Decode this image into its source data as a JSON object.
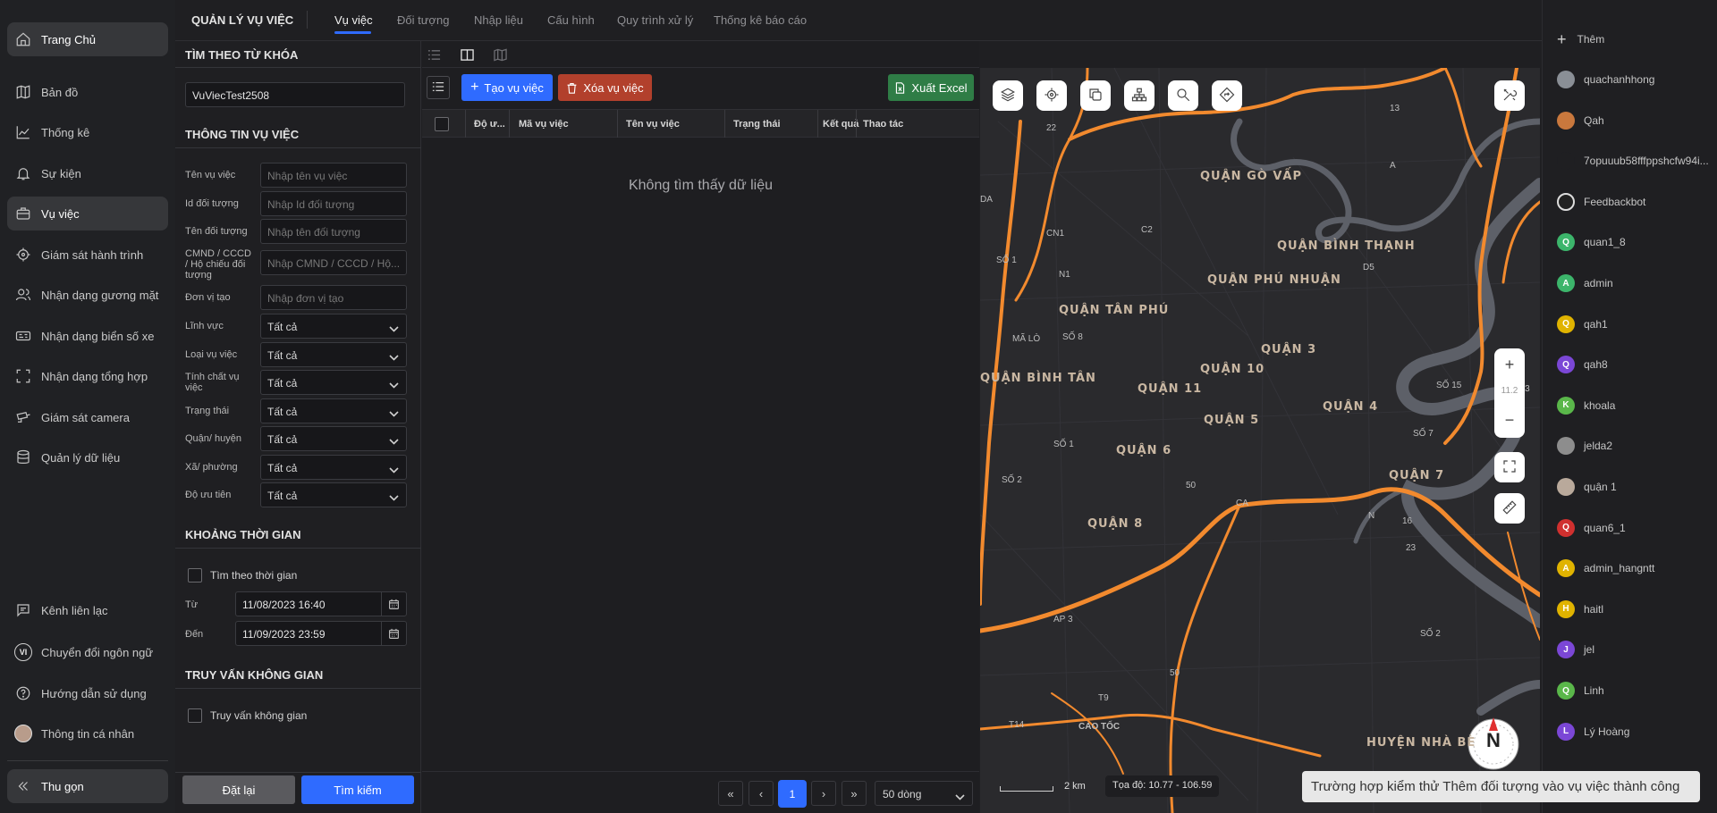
{
  "topbar": {
    "app_title": "QUẢN LÝ VỤ VIỆC",
    "tabs": [
      "Vụ việc",
      "Đối tượng",
      "Nhập liệu",
      "Cấu hình",
      "Quy trình xử lý",
      "Thống kê báo cáo"
    ],
    "active_tab": "Vụ việc"
  },
  "leftnav": {
    "items": [
      {
        "label": "Trang Chủ",
        "icon": "home-icon"
      },
      {
        "label": "Bản đồ",
        "icon": "map-icon"
      },
      {
        "label": "Thống kê",
        "icon": "chart-icon"
      },
      {
        "label": "Sự kiện",
        "icon": "bell-icon"
      },
      {
        "label": "Vụ việc",
        "icon": "briefcase-icon"
      },
      {
        "label": "Giám sát hành trình",
        "icon": "target-icon"
      },
      {
        "label": "Nhận dạng gương mặt",
        "icon": "face-icon"
      },
      {
        "label": "Nhận dạng biển số xe",
        "icon": "plate-icon"
      },
      {
        "label": "Nhận dạng tổng hợp",
        "icon": "scan-icon"
      },
      {
        "label": "Giám sát camera",
        "icon": "camera-icon"
      },
      {
        "label": "Quản lý dữ liệu",
        "icon": "database-icon"
      }
    ],
    "bottom_items": [
      {
        "label": "Kênh liên lạc",
        "icon": "chat-icon"
      },
      {
        "label": "Chuyển đổi ngôn ngữ",
        "icon": "language-icon",
        "badge": "VI"
      },
      {
        "label": "Hướng dẫn sử dụng",
        "icon": "help-icon"
      },
      {
        "label": "Thông tin cá nhân",
        "icon": "avatar-icon"
      }
    ],
    "collapse_label": "Thu gọn"
  },
  "filter": {
    "keyword_title": "TÌM THEO TỪ KHÓA",
    "keyword_value": "VuViecTest2508",
    "info_title": "THÔNG TIN VỤ VIỆC",
    "text_fields": [
      {
        "label": "Tên vụ việc",
        "placeholder": "Nhập tên vụ việc"
      },
      {
        "label": "Id đối tượng",
        "placeholder": "Nhập Id đối tượng"
      },
      {
        "label": "Tên đối tượng",
        "placeholder": "Nhập tên đối tượng"
      },
      {
        "label": "CMND / CCCD / Hộ chiếu đối tượng",
        "placeholder": "Nhập CMND / CCCD / Hộ..."
      },
      {
        "label": "Đơn vị tạo",
        "placeholder": "Nhập đơn vị tạo"
      }
    ],
    "select_fields": [
      {
        "label": "Lĩnh vực",
        "value": "Tất cả"
      },
      {
        "label": "Loại vụ việc",
        "value": "Tất cả"
      },
      {
        "label": "Tính chất vụ việc",
        "value": "Tất cả"
      },
      {
        "label": "Trạng thái",
        "value": "Tất cả"
      },
      {
        "label": "Quận/ huyện",
        "value": "Tất cả"
      },
      {
        "label": "Xã/ phường",
        "value": "Tất cả"
      },
      {
        "label": "Độ ưu tiên",
        "value": "Tất cả"
      }
    ],
    "time_title": "KHOẢNG THỜI GIAN",
    "time_checkbox": "Tìm theo thời gian",
    "from_label": "Từ",
    "from_value": "11/08/2023 16:40",
    "to_label": "Đến",
    "to_value": "11/09/2023 23:59",
    "spatial_title": "TRUY VẤN KHÔNG GIAN",
    "spatial_checkbox": "Truy vấn không gian",
    "reset_label": "Đặt lại",
    "search_label": "Tìm kiếm"
  },
  "table": {
    "create_label": "Tạo vụ việc",
    "delete_label": "Xóa vụ việc",
    "export_label": "Xuất Excel",
    "columns": [
      "Độ ư...",
      "Mã vụ việc",
      "Tên vụ việc",
      "Trạng thái",
      "Kết quả",
      "Thao tác"
    ],
    "empty_text": "Không tìm thấy dữ liệu",
    "current_page": "1",
    "page_size": "50 dòng"
  },
  "map": {
    "district_labels": [
      "QUẬN GÒ VẤP",
      "QUẬN BÌNH THẠNH",
      "QUẬN PHÚ NHUẬN",
      "QUẬN TÂN PHÚ",
      "QUẬN 3",
      "QUẬN 10",
      "QUẬN BÌNH TÂN",
      "QUẬN 11",
      "QUẬN 5",
      "QUẬN 4",
      "QUẬN 6",
      "QUẬN 7",
      "QUẬN 8",
      "HUYỆN NHÀ BÈ"
    ],
    "road_labels": [
      "22",
      "13",
      "CN1",
      "C2",
      "D5",
      "N1",
      "A",
      "SỐ 1",
      "SỐ 8",
      "MÃ LÒ",
      "SỐ 15",
      "SỐ 7",
      "103",
      "SỐ 2",
      "50",
      "CA",
      "16",
      "23",
      "SỐ 1",
      "AP 3",
      "SỐ 2",
      "T9",
      "T14",
      "CAO TỐC",
      "50",
      "DA",
      "N"
    ],
    "zoom_level": "11.2",
    "scale_label": "2 km",
    "coord_label": "Tọa độ:",
    "coord_lat": "10.77",
    "coord_sep": "-",
    "coord_lng": "106.59",
    "compass_label": "N"
  },
  "rightbar": {
    "add_label": "Thêm",
    "users": [
      {
        "name": "quachanhhong",
        "initial": "",
        "color": "#8a8f96"
      },
      {
        "name": "Qah",
        "initial": "",
        "color": "#c9783d"
      },
      {
        "name": "7opuuub58fffppshcfw94i...",
        "initial": "",
        "color": "#1f1f22"
      },
      {
        "name": "Feedbackbot",
        "initial": "",
        "color": "#222"
      },
      {
        "name": "quan1_8",
        "initial": "Q",
        "color": "#3cb56b"
      },
      {
        "name": "admin",
        "initial": "A",
        "color": "#3cb56b"
      },
      {
        "name": "qah1",
        "initial": "Q",
        "color": "#e0b300"
      },
      {
        "name": "qah8",
        "initial": "Q",
        "color": "#7b47d6"
      },
      {
        "name": "khoala",
        "initial": "K",
        "color": "#5ab74a"
      },
      {
        "name": "jelda2",
        "initial": "",
        "color": "#8d8d8d"
      },
      {
        "name": "quận 1",
        "initial": "",
        "color": "#b9a99b"
      },
      {
        "name": "quan6_1",
        "initial": "Q",
        "color": "#d0302f"
      },
      {
        "name": "admin_hangntt",
        "initial": "A",
        "color": "#e0b300"
      },
      {
        "name": "haitl",
        "initial": "H",
        "color": "#e0b300"
      },
      {
        "name": "jel",
        "initial": "J",
        "color": "#7b47d6"
      },
      {
        "name": "Linh",
        "initial": "Q",
        "color": "#5ab74a"
      },
      {
        "name": "Lý Hoàng",
        "initial": "L",
        "color": "#7b47d6"
      }
    ]
  },
  "toast": {
    "message": "Trường hợp kiểm thử Thêm đối tượng vào vụ việc thành công"
  },
  "colors": {
    "accent": "#2f6bff",
    "danger": "#b2402c",
    "success": "#2f7d46",
    "road": "#f28a2e",
    "river": "#5d6068"
  }
}
